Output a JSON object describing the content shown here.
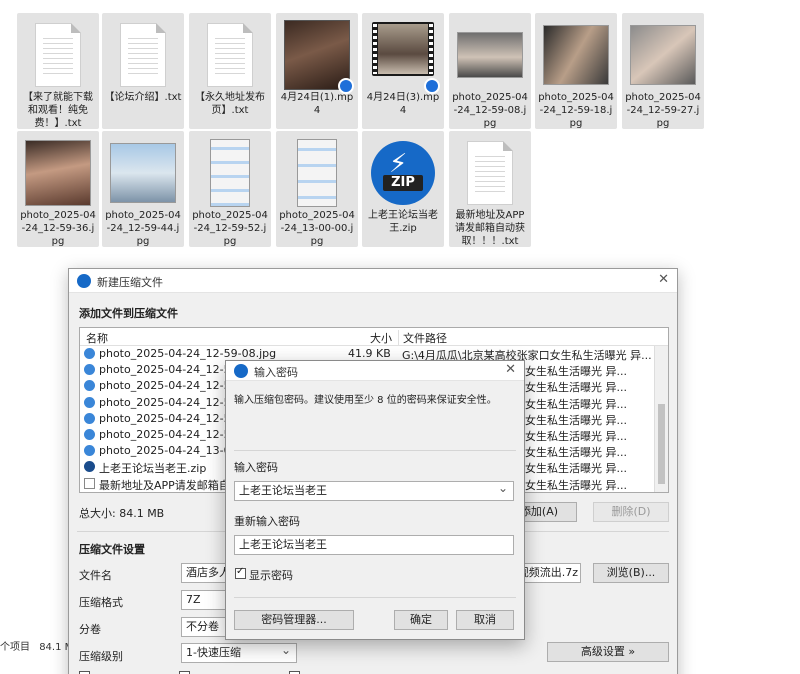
{
  "files": [
    {
      "name": "【来了就能下载和观看！纯免费！】.txt",
      "kind": "txt"
    },
    {
      "name": "【论坛介绍】.txt",
      "kind": "txt"
    },
    {
      "name": "【永久地址发布页】.txt",
      "kind": "txt"
    },
    {
      "name": "4月24日(1).mp4",
      "kind": "video"
    },
    {
      "name": "4月24日(3).mp4",
      "kind": "video"
    },
    {
      "name": "photo_2025-04-24_12-59-08.jpg",
      "kind": "photo"
    },
    {
      "name": "photo_2025-04-24_12-59-18.jpg",
      "kind": "photo"
    },
    {
      "name": "photo_2025-04-24_12-59-27.jpg",
      "kind": "photo"
    },
    {
      "name": "photo_2025-04-24_12-59-36.jpg",
      "kind": "photo"
    },
    {
      "name": "photo_2025-04-24_12-59-44.jpg",
      "kind": "photo"
    },
    {
      "name": "photo_2025-04-24_12-59-52.jpg",
      "kind": "screenshot"
    },
    {
      "name": "photo_2025-04-24_13-00-00.jpg",
      "kind": "screenshot"
    },
    {
      "name": "上老王论坛当老王.zip",
      "kind": "zip"
    },
    {
      "name": "最新地址及APP请发邮箱自动获取！！！.txt",
      "kind": "txt"
    }
  ],
  "zip_icon_label": "ZIP",
  "statusbar": {
    "items_label": "个项目",
    "size": "84.1 MB"
  },
  "main_dialog": {
    "title": "新建压缩文件",
    "section_add": "添加文件到压缩文件",
    "columns": {
      "name": "名称",
      "size": "大小",
      "path": "文件路径"
    },
    "rows": [
      {
        "name": "photo_2025-04-24_12-59-08.jpg",
        "size": "41.9 KB",
        "path": "G:\\4月瓜瓜\\北京某高校张家口女生私生活曝光 异..."
      },
      {
        "name": "photo_2025-04-24_12-59-18.jpg",
        "size": "",
        "path": "女生私生活曝光 异..."
      },
      {
        "name": "photo_2025-04-24_12-59-27.jpg",
        "size": "",
        "path": "女生私生活曝光 异..."
      },
      {
        "name": "photo_2025-04-24_12-59-36.jpg",
        "size": "",
        "path": "女生私生活曝光 异..."
      },
      {
        "name": "photo_2025-04-24_12-59-44.jpg",
        "size": "",
        "path": "女生私生活曝光 异..."
      },
      {
        "name": "photo_2025-04-24_12-59-52.jpg",
        "size": "",
        "path": "女生私生活曝光 异..."
      },
      {
        "name": "photo_2025-04-24_13-00-00.jpg",
        "size": "",
        "path": "女生私生活曝光 异..."
      },
      {
        "name": "上老王论坛当老王.zip",
        "size": "",
        "path": "女生私生活曝光 异..."
      },
      {
        "name": "最新地址及APP请发邮箱自动获取",
        "size": "",
        "path": "女生私生活曝光 异..."
      }
    ],
    "total_size": "总大小: 84.1 MB",
    "add_button": "添加(A)",
    "delete_button": "删除(D)",
    "section_settings": "压缩文件设置",
    "filename_label": "文件名",
    "filename_value": "酒店多人刺",
    "filename_tail": "视频流出.7z",
    "browse_button": "浏览(B)...",
    "format_label": "压缩格式",
    "format_value": "7Z",
    "split_label": "分卷",
    "split_value": "不分卷",
    "level_label": "压缩级别",
    "level_value": "1-快速压缩",
    "advanced_button": "高级设置 »"
  },
  "password_dialog": {
    "title": "输入密码",
    "hint": "输入压缩包密码。建议使用至少 8 位的密码来保证安全性。",
    "enter_label": "输入密码",
    "enter_value": "上老王论坛当老王",
    "reenter_label": "重新输入密码",
    "reenter_value": "上老王论坛当老王",
    "show_password_label": "显示密码",
    "show_password_checked": true,
    "manager_button": "密码管理器...",
    "ok_button": "确定",
    "cancel_button": "取消"
  }
}
